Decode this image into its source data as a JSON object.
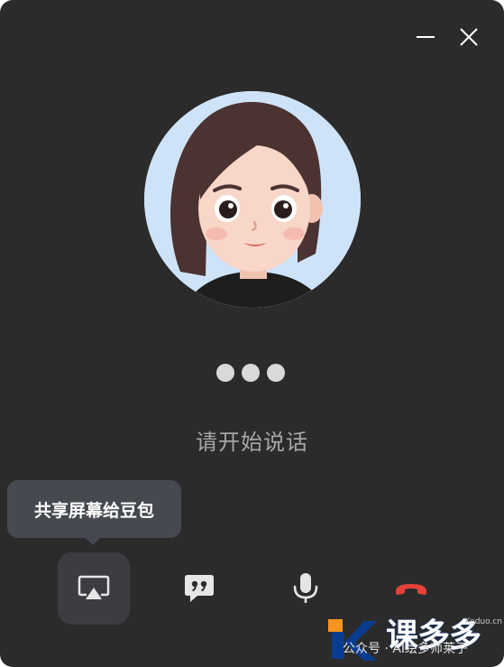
{
  "window": {
    "controls": {
      "minimize_icon": "minimize-icon",
      "close_icon": "close-icon"
    }
  },
  "avatar": {
    "icon": "girl-avatar-image"
  },
  "status": {
    "thinking_icon": "typing-dots-icon",
    "text": "请开始说话"
  },
  "tooltip": {
    "text": "共享屏幕给豆包"
  },
  "controls": [
    {
      "id": "share-screen",
      "icon": "airplay-screen-icon"
    },
    {
      "id": "subtitles",
      "icon": "quote-bubble-icon"
    },
    {
      "id": "microphone",
      "icon": "microphone-icon"
    },
    {
      "id": "hang-up",
      "icon": "hangup-phone-icon"
    }
  ],
  "watermark": {
    "brand": "课多多",
    "subtitle": "公众号 · AI绘多师莱子",
    "domain": "Keduo.cn"
  },
  "colors": {
    "background": "#2b2b2b",
    "avatar_bg": "#cfe3f8",
    "hangup_red": "#e5403a",
    "tooltip_bg": "#464a50",
    "active_button_bg": "#3b3d42",
    "watermark_orange": "#f7941d",
    "watermark_blue": "#0a3d8f"
  }
}
